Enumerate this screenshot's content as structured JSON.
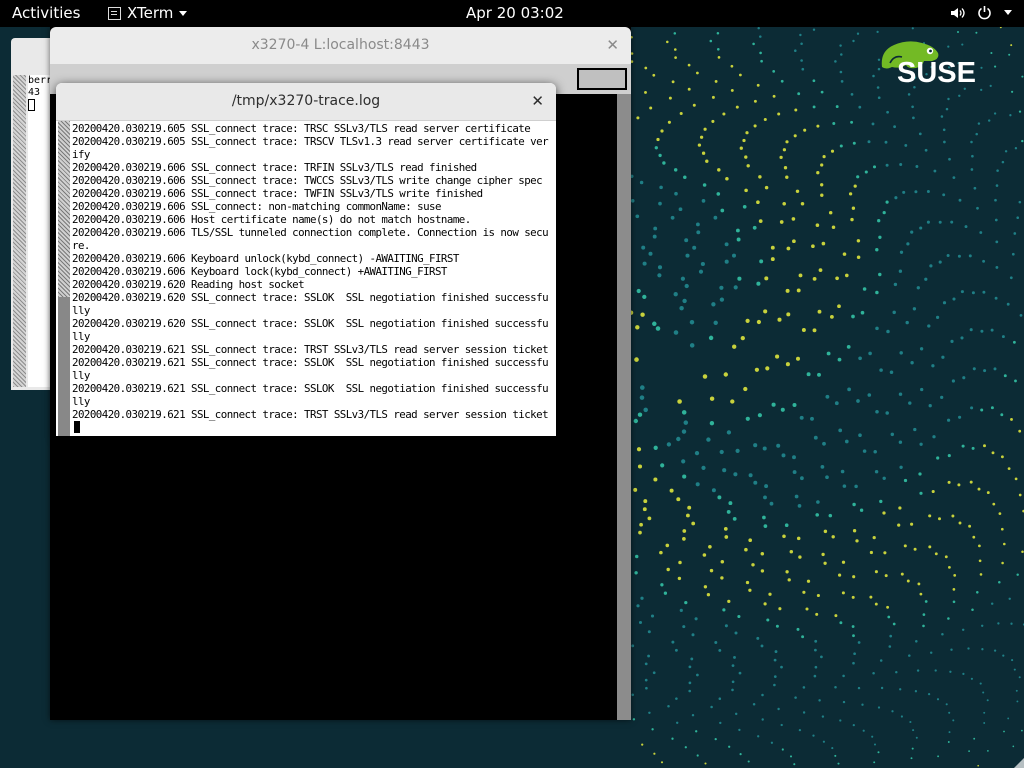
{
  "topbar": {
    "activities": "Activities",
    "app_name": "XTerm",
    "clock": "Apr 20  03:02",
    "icons": [
      "volume-icon",
      "power-icon",
      "chevron-down-icon"
    ]
  },
  "logo": {
    "text": "SUSE",
    "color": "#73ba25"
  },
  "bg_window": {
    "lines": [
      "berr",
      "43"
    ]
  },
  "x3270": {
    "title": "x3270-4 L:localhost:8443"
  },
  "trace": {
    "title": "/tmp/x3270-trace.log",
    "lines": [
      "20200420.030219.605 SSL_connect trace: TRSC SSLv3/TLS read server certificate",
      "20200420.030219.605 SSL_connect trace: TRSCV TLSv1.3 read server certificate ver",
      "ify",
      "20200420.030219.606 SSL_connect trace: TRFIN SSLv3/TLS read finished",
      "20200420.030219.606 SSL_connect trace: TWCCS SSLv3/TLS write change cipher spec",
      "20200420.030219.606 SSL_connect trace: TWFIN SSLv3/TLS write finished",
      "20200420.030219.606 SSL_connect: non-matching commonName: suse",
      "20200420.030219.606 Host certificate name(s) do not match hostname.",
      "20200420.030219.606 TLS/SSL tunneled connection complete. Connection is now secu",
      "re.",
      "20200420.030219.606 Keyboard unlock(kybd_connect) -AWAITING_FIRST",
      "20200420.030219.606 Keyboard lock(kybd_connect) +AWAITING_FIRST",
      "20200420.030219.620 Reading host socket",
      "20200420.030219.620 SSL_connect trace: SSLOK  SSL negotiation finished successfu",
      "lly",
      "20200420.030219.620 SSL_connect trace: SSLOK  SSL negotiation finished successfu",
      "lly",
      "20200420.030219.621 SSL_connect trace: TRST SSLv3/TLS read server session ticket",
      "20200420.030219.621 SSL_connect trace: SSLOK  SSL negotiation finished successfu",
      "lly",
      "20200420.030219.621 SSL_connect trace: SSLOK  SSL negotiation finished successfu",
      "lly",
      "20200420.030219.621 SSL_connect trace: TRST SSLv3/TLS read server session ticket"
    ]
  }
}
